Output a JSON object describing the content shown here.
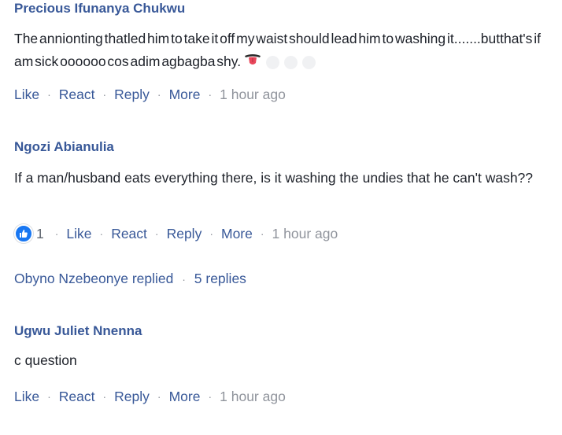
{
  "comments": [
    {
      "author": "Precious Ifunanya Chukwu",
      "text": "The annionting thatled him to take it off my waist should lead him to washing it.......butthat's if am sick oooooo cos adim agbagba shy.",
      "emoji": "tongue-out-emoji",
      "actions": {
        "like": "Like",
        "react": "React",
        "reply": "Reply",
        "more": "More",
        "time": "1 hour ago"
      }
    },
    {
      "author": "Ngozi Abianulia",
      "text": "If a man/husband eats everything there, is it washing the undies that he can't wash??",
      "reaction_count": "1",
      "reaction_icon": "thumbs-up-icon",
      "actions": {
        "like": "Like",
        "react": "React",
        "reply": "Reply",
        "more": "More",
        "time": "1 hour ago"
      },
      "replies": {
        "replied_by": "Obyno Nzebeonye replied",
        "count": "5 replies"
      }
    },
    {
      "author": "Ugwu Juliet Nnenna",
      "text": "c question",
      "actions": {
        "like": "Like",
        "react": "React",
        "reply": "Reply",
        "more": "More",
        "time": "1 hour ago"
      }
    }
  ],
  "colors": {
    "author": "#385898",
    "text": "#1d2129",
    "action": "#385898",
    "muted": "#90949c",
    "like_badge": "#1877f2"
  }
}
